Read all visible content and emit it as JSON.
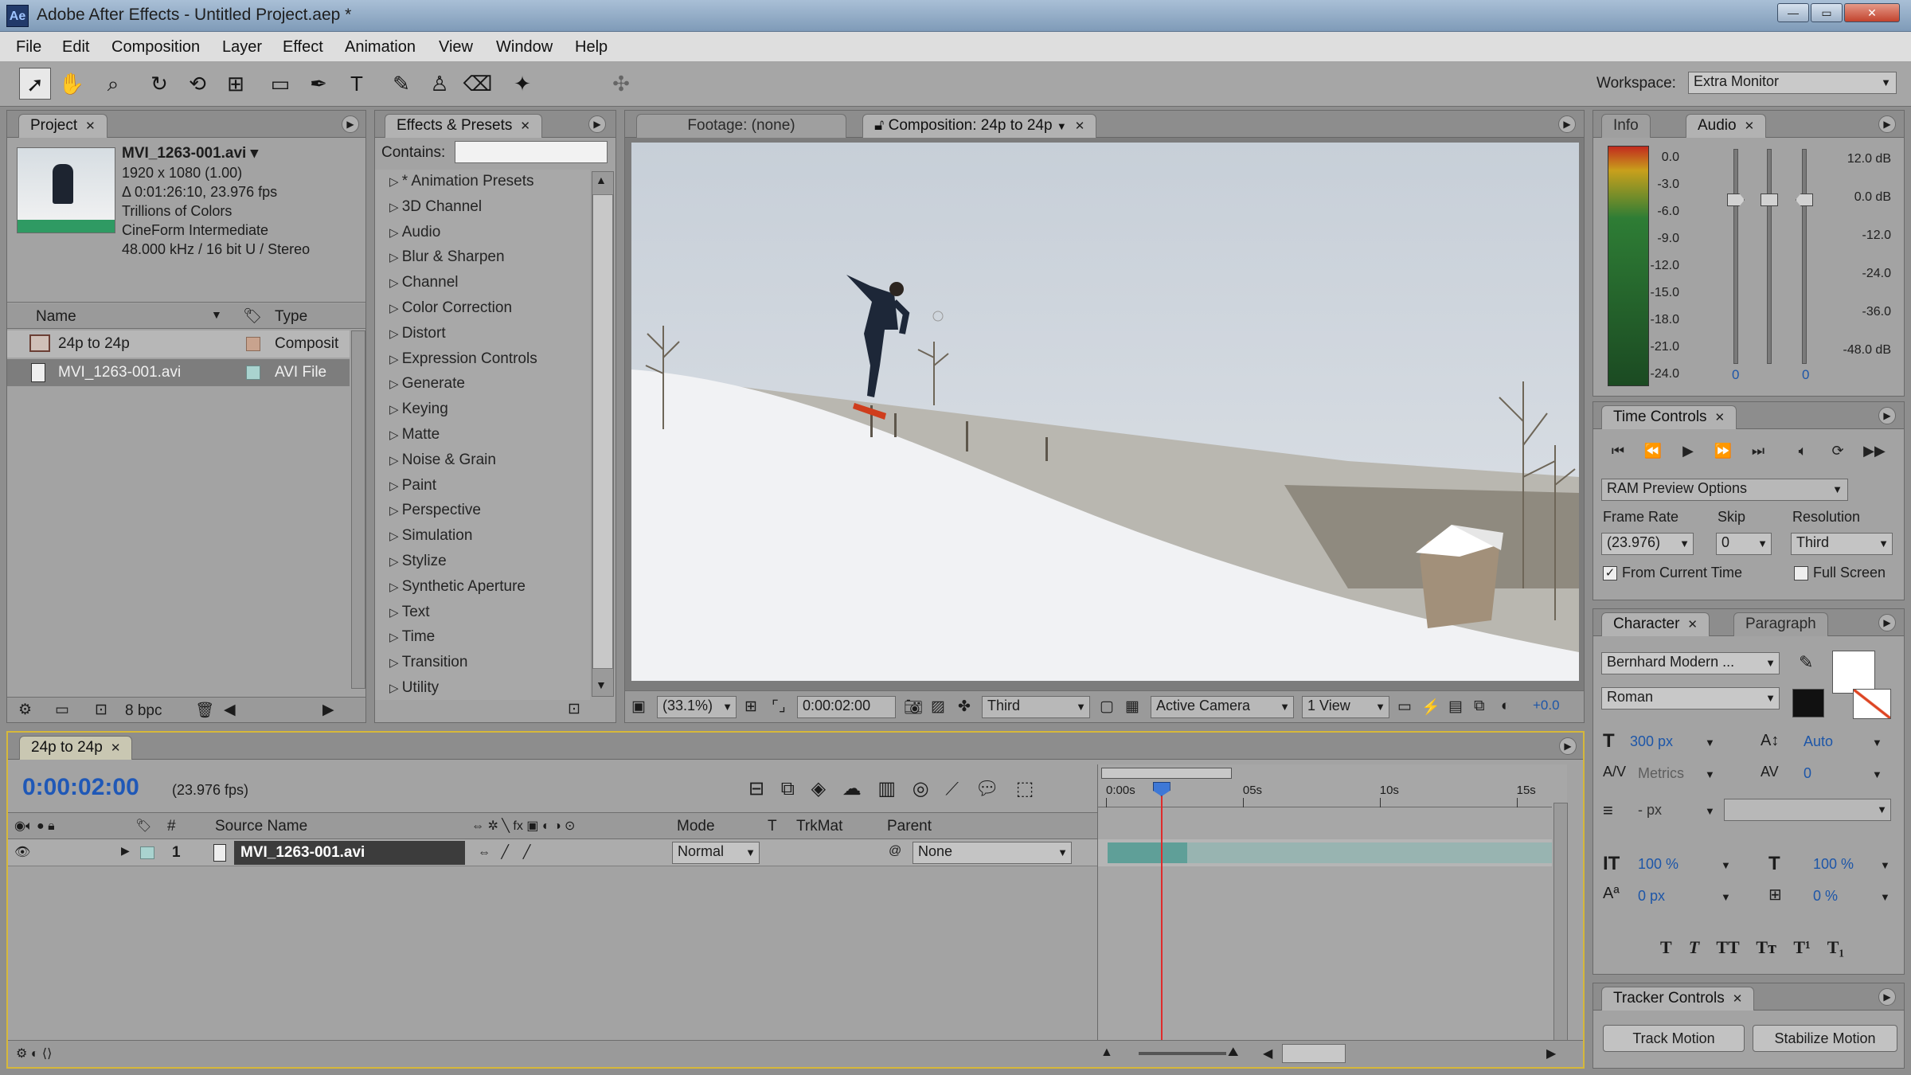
{
  "window": {
    "title": "Adobe After Effects - Untitled Project.aep *",
    "app_icon": "Ae",
    "buttons": [
      "minimize",
      "maximize",
      "close"
    ]
  },
  "menu": [
    "File",
    "Edit",
    "Composition",
    "Layer",
    "Effect",
    "Animation",
    "View",
    "Window",
    "Help"
  ],
  "toolbar": {
    "tools": [
      "selection-icon",
      "hand-icon",
      "zoom-icon",
      "rotate-icon",
      "camera-orbit-icon",
      "pan-behind-icon",
      "rectangle-mask-icon",
      "pen-icon",
      "type-icon",
      "brush-icon",
      "clone-stamp-icon",
      "eraser-icon",
      "puppet-pin-icon"
    ],
    "workspace_label": "Workspace:",
    "workspace_value": "Extra Monitor"
  },
  "project": {
    "tab": "Project",
    "file_name": "MVI_1263-001.avi ▾",
    "info": [
      "1920 x 1080 (1.00)",
      "Δ 0:01:26:10, 23.976 fps",
      "Trillions of Colors",
      "CineForm Intermediate",
      "48.000 kHz / 16 bit U / Stereo"
    ],
    "col_name": "Name",
    "col_type": "Type",
    "items": [
      {
        "name": "24p to 24p",
        "type": "Composit"
      },
      {
        "name": "MVI_1263-001.avi",
        "type": "AVI File"
      }
    ],
    "bpc": "8 bpc"
  },
  "effects": {
    "tab": "Effects & Presets",
    "contains_label": "Contains:",
    "contains_value": "",
    "items": [
      "* Animation Presets",
      "3D Channel",
      "Audio",
      "Blur & Sharpen",
      "Channel",
      "Color Correction",
      "Distort",
      "Expression Controls",
      "Generate",
      "Keying",
      "Matte",
      "Noise & Grain",
      "Paint",
      "Perspective",
      "Simulation",
      "Stylize",
      "Synthetic Aperture",
      "Text",
      "Time",
      "Transition",
      "Utility"
    ]
  },
  "viewer": {
    "tab_footage": "Footage: (none)",
    "tab_comp": "Composition: 24p to 24p",
    "zoom": "(33.1%)",
    "timecode": "0:00:02:00",
    "resolution": "Third",
    "camera": "Active Camera",
    "views": "1 View",
    "offset": "+0.0"
  },
  "audio": {
    "tab_info": "Info",
    "tab_audio": "Audio",
    "db_left": [
      "0.0",
      "-3.0",
      "-6.0",
      "-9.0",
      "-12.0",
      "-15.0",
      "-18.0",
      "-21.0",
      "-24.0"
    ],
    "db_right": [
      "12.0 dB",
      "0.0 dB",
      "-12.0",
      "-24.0",
      "-36.0",
      "-48.0 dB"
    ],
    "slider_val_left": "0",
    "slider_val_right": "0"
  },
  "time_controls": {
    "tab": "Time Controls",
    "ram_preview": "RAM Preview Options",
    "frame_rate_label": "Frame Rate",
    "skip_label": "Skip",
    "resolution_label": "Resolution",
    "frame_rate": "(23.976)",
    "skip": "0",
    "resolution": "Third",
    "from_current": "From Current Time",
    "full_screen": "Full Screen",
    "from_current_checked": true,
    "full_screen_checked": false
  },
  "character": {
    "tab": "Character",
    "tab2": "Paragraph",
    "font": "Bernhard Modern ...",
    "style": "Roman",
    "size": "300 px",
    "leading": "Auto",
    "kerning": "Metrics",
    "tracking": "0",
    "stroke_unit": "- px",
    "vscale": "100 %",
    "hscale": "100 %",
    "baseline": "0 px",
    "tsume": "0 %",
    "styles": [
      "T",
      "T",
      "TT",
      "Tт",
      "T¹",
      "T₁"
    ]
  },
  "tracker": {
    "tab": "Tracker Controls",
    "track": "Track Motion",
    "stabilize": "Stabilize Motion"
  },
  "timeline": {
    "tab": "24p to 24p",
    "timecode": "0:00:02:00",
    "fps": "(23.976 fps)",
    "cols": {
      "source": "Source Name",
      "mode": "Mode",
      "t": "T",
      "trkmat": "TrkMat",
      "parent": "Parent"
    },
    "layer": {
      "num": "1",
      "name": "MVI_1263-001.avi",
      "mode": "Normal",
      "parent": "None"
    },
    "ruler": [
      "0:00s",
      "05s",
      "10s",
      "15s"
    ],
    "playhead_time_s": 2,
    "ruler_max_s": 16
  }
}
